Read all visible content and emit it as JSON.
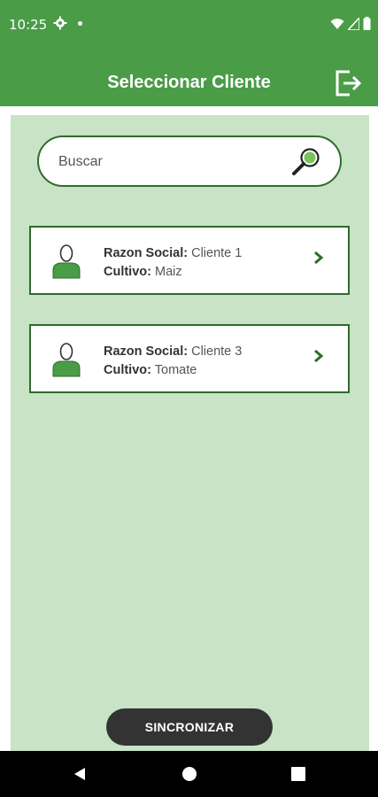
{
  "status_bar": {
    "time": "10:25",
    "icons": [
      "gear-icon",
      "dot-icon",
      "wifi-icon",
      "signal-icon",
      "battery-icon"
    ]
  },
  "toolbar": {
    "title": "Seleccionar Cliente",
    "logout_icon": "logout-icon"
  },
  "search": {
    "placeholder": "Buscar",
    "value": "",
    "icon": "search-icon"
  },
  "clients": [
    {
      "razon_label": "Razon Social:",
      "razon_value": "Cliente 1",
      "cultivo_label": "Cultivo:",
      "cultivo_value": "Maiz"
    },
    {
      "razon_label": "Razon Social:",
      "razon_value": "Cliente 3",
      "cultivo_label": "Cultivo:",
      "cultivo_value": "Tomate"
    }
  ],
  "sync_button": {
    "label": "SINCRONIZAR"
  },
  "nav": {
    "icons": [
      "back-icon",
      "home-icon",
      "recents-icon"
    ]
  },
  "colors": {
    "primary": "#4a9c47",
    "dark_green": "#2e6b2c",
    "content_bg": "#c8e3c6",
    "sync_bg": "#333333"
  }
}
